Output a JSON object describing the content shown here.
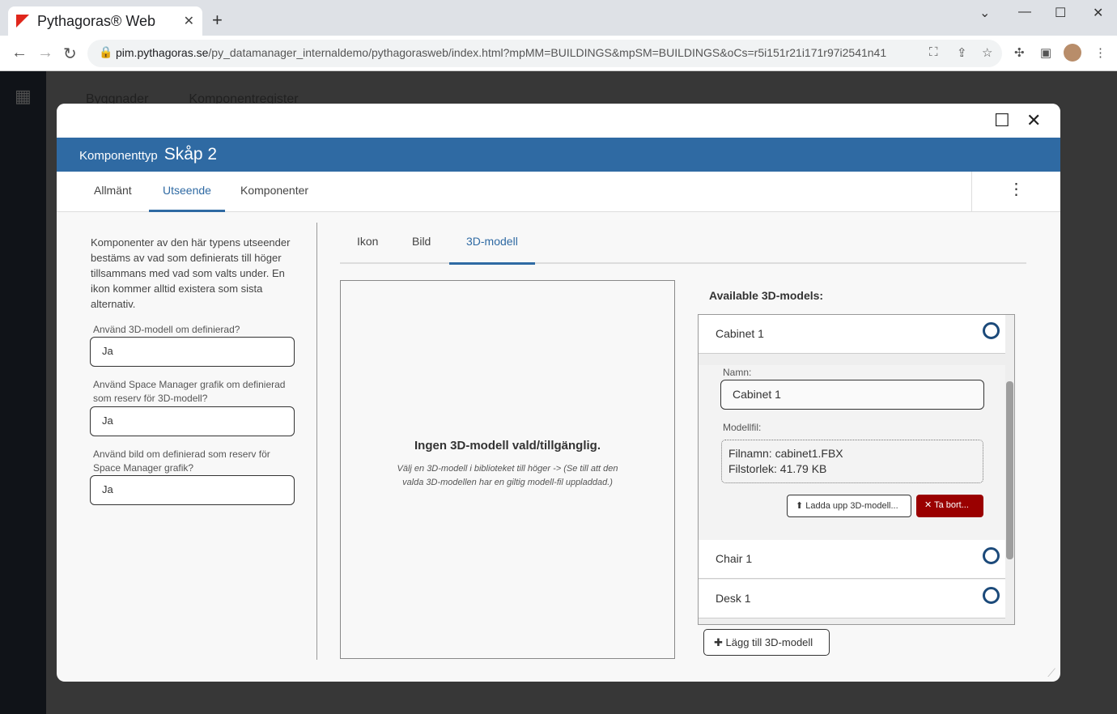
{
  "browser": {
    "tab_title": "Pythagoras® Web",
    "url_host": "pim.pythagoras.se",
    "url_path": "/py_datamanager_internaldemo/pythagorasweb/index.html?mpMM=BUILDINGS&mpSM=BUILDINGS&oCs=r5i151r21i171r97i2541n41"
  },
  "app": {
    "nav": [
      "Byggnader",
      "Komponentregister"
    ]
  },
  "modal": {
    "type_label": "Komponenttyp",
    "title": "Skåp 2",
    "tabs": [
      "Allmänt",
      "Utseende",
      "Komponenter"
    ],
    "description": "Komponenter av den här typens utseender bestäms av vad som definierats till höger tillsammans med vad som valts under. En ikon kommer alltid existera som sista alternativ.",
    "fields": [
      {
        "label": "Använd 3D-modell om definierad?",
        "value": "Ja"
      },
      {
        "label": "Använd Space Manager grafik om definierad som reserv för 3D-modell?",
        "value": "Ja"
      },
      {
        "label": "Använd bild om definierad som reserv för Space Manager grafik?",
        "value": "Ja"
      }
    ],
    "subtabs": [
      "Ikon",
      "Bild",
      "3D-modell"
    ],
    "preview": {
      "title": "Ingen 3D-modell vald/tillgänglig.",
      "hint": "Välj en 3D-modell i biblioteket till höger -> (Se till att den valda 3D-modellen har en giltig modell-fil uppladdad.)"
    },
    "available_label": "Available 3D-models:",
    "models": [
      "Cabinet 1",
      "Chair 1",
      "Desk 1"
    ],
    "detail": {
      "name_label": "Namn:",
      "name_value": "Cabinet 1",
      "file_label": "Modellfil:",
      "filename": "Filnamn: cabinet1.FBX",
      "filesize": "Filstorlek: 41.79 KB",
      "upload": "Ladda upp 3D-modell...",
      "remove": "Ta bort..."
    },
    "add_button": "Lägg till 3D-modell"
  }
}
